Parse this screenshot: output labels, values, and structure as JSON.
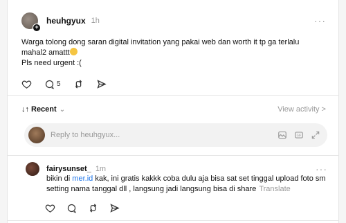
{
  "post": {
    "username": "heuhgyux",
    "time": "1h",
    "more": "···",
    "text_line1": "Warga tolong dong saran digital invitation yang pakai web dan worth it tp ga terlalu",
    "text_line2": "mahal2 amattt",
    "text_line3": "Pls need urgent :(",
    "reply_count": "5"
  },
  "sort": {
    "arrows": "↓↑",
    "label": "Recent",
    "view_activity": "View activity >"
  },
  "reply": {
    "placeholder": "Reply to heuhgyux..."
  },
  "comment": {
    "username": "fairysunset_",
    "time": "1m",
    "more": "···",
    "text_pre": "bikin di ",
    "link": "mer.id",
    "text_post": " kak, ini gratis kakkk coba dulu aja bisa sat set tinggal upload foto sm setting nama tanggal dll , langsung jadi langsung bisa di share",
    "translate": "Translate"
  },
  "icons": {
    "like": "heart-icon",
    "reply": "speech-bubble-icon",
    "repost": "repost-icon",
    "share": "send-icon",
    "image": "image-icon",
    "gif": "gif-icon",
    "expand": "expand-icon"
  }
}
